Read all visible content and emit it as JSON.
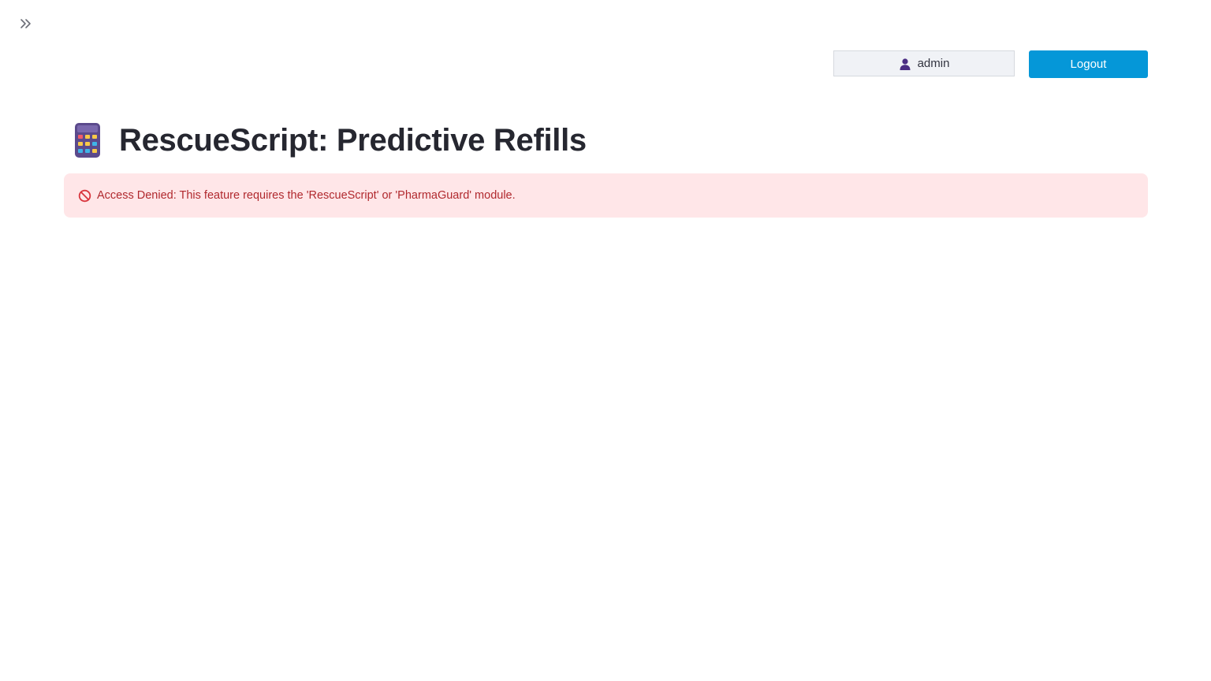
{
  "sidebar": {
    "toggle_icon": "chevron-double-right-icon"
  },
  "header": {
    "user": {
      "icon": "user-icon",
      "name": "admin"
    },
    "logout_label": "Logout"
  },
  "main": {
    "title_icon": "calculator-icon",
    "title": "RescueScript: Predictive Refills",
    "alert": {
      "icon": "no-entry-icon",
      "text": "Access Denied: This feature requires the 'RescueScript' or 'PharmaGuard' module."
    }
  },
  "colors": {
    "primary": "#0597d8",
    "error_bg": "#ffe6e8",
    "error_text": "#b0292e",
    "chip_bg": "#f0f2f6"
  }
}
